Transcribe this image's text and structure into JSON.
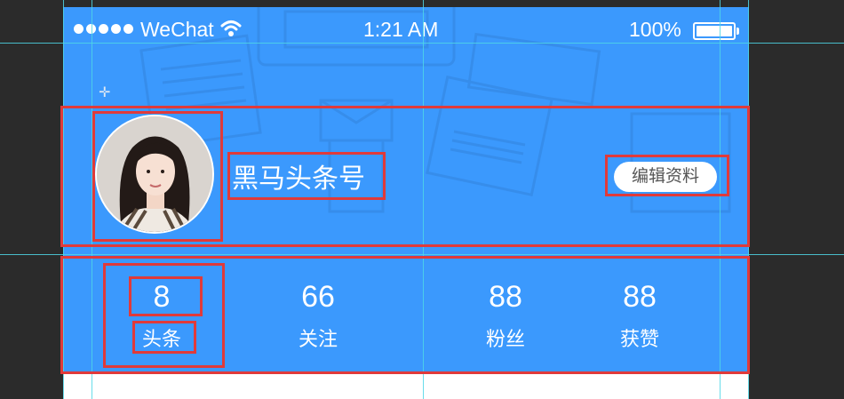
{
  "status_bar": {
    "carrier": "WeChat",
    "time": "1:21 AM",
    "battery": "100%"
  },
  "profile": {
    "name": "黑马头条号",
    "edit_button": "编辑资料"
  },
  "stats": [
    {
      "value": "8",
      "label": "头条"
    },
    {
      "value": "66",
      "label": "关注"
    },
    {
      "value": "88",
      "label": "粉丝"
    },
    {
      "value": "88",
      "label": "获赞"
    }
  ],
  "colors": {
    "header_blue": "#3b99fd",
    "annotation_red": "#e03a3a",
    "guide_cyan": "#4fd6e6"
  },
  "icons": [
    "signal-dots-icon",
    "wifi-icon",
    "battery-icon",
    "crosshair-icon"
  ]
}
